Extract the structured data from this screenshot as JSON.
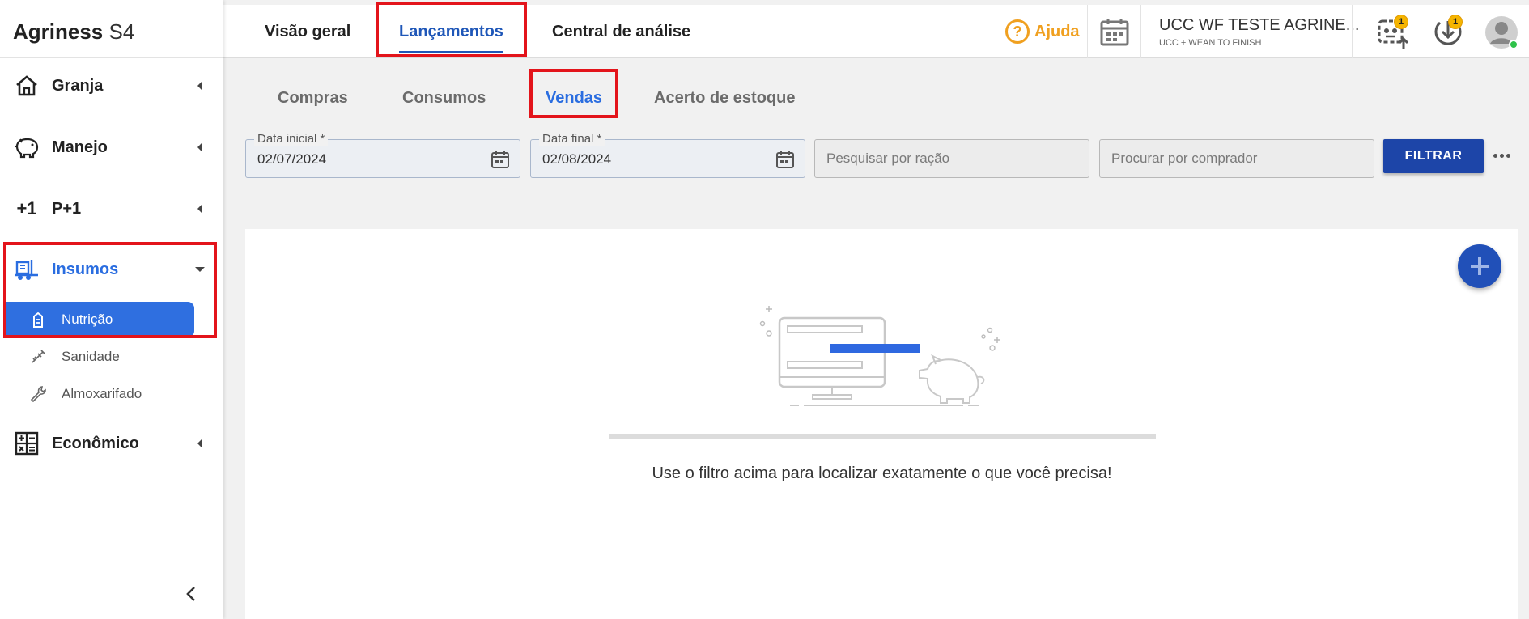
{
  "app": {
    "brand_name": "Agriness",
    "brand_suffix": "S4"
  },
  "sidebar": {
    "items": [
      {
        "label": "Granja",
        "icon": "house-icon"
      },
      {
        "label": "Manejo",
        "icon": "pig-icon"
      },
      {
        "label": "P+1",
        "icon": "plus-one-icon"
      },
      {
        "label": "Insumos",
        "icon": "forklift-icon",
        "expanded": true
      },
      {
        "label": "Econômico",
        "icon": "calculator-icon"
      }
    ],
    "subitems": [
      {
        "label": "Nutrição",
        "icon": "silo-icon",
        "active": true
      },
      {
        "label": "Sanidade",
        "icon": "syringe-icon"
      },
      {
        "label": "Almoxarifado",
        "icon": "wrench-icon"
      }
    ]
  },
  "topbar": {
    "tabs": [
      {
        "label": "Visão geral"
      },
      {
        "label": "Lançamentos",
        "active": true
      },
      {
        "label": "Central de análise"
      }
    ],
    "help_label": "Ajuda",
    "help_symbol": "?",
    "farm_name": "UCC WF TESTE AGRINE...",
    "farm_sub": "UCC + WEAN TO FINISH",
    "notif_count_1": "1",
    "notif_count_2": "1"
  },
  "subtabs": [
    {
      "label": "Compras"
    },
    {
      "label": "Consumos"
    },
    {
      "label": "Vendas",
      "active": true
    },
    {
      "label": "Acerto de estoque"
    }
  ],
  "filters": {
    "date_start_label": "Data inicial *",
    "date_start_value": "02/07/2024",
    "date_end_label": "Data final *",
    "date_end_value": "02/08/2024",
    "search_feed_placeholder": "Pesquisar por ração",
    "search_buyer_placeholder": "Procurar por comprador",
    "filter_button": "FILTRAR"
  },
  "empty_state": {
    "message": "Use o filtro acima para localizar exatamente o que você precisa!"
  },
  "colors": {
    "accent": "#2a6de0",
    "primary_button": "#1d45a8",
    "help": "#f0a020",
    "highlight": "#e3141b"
  }
}
